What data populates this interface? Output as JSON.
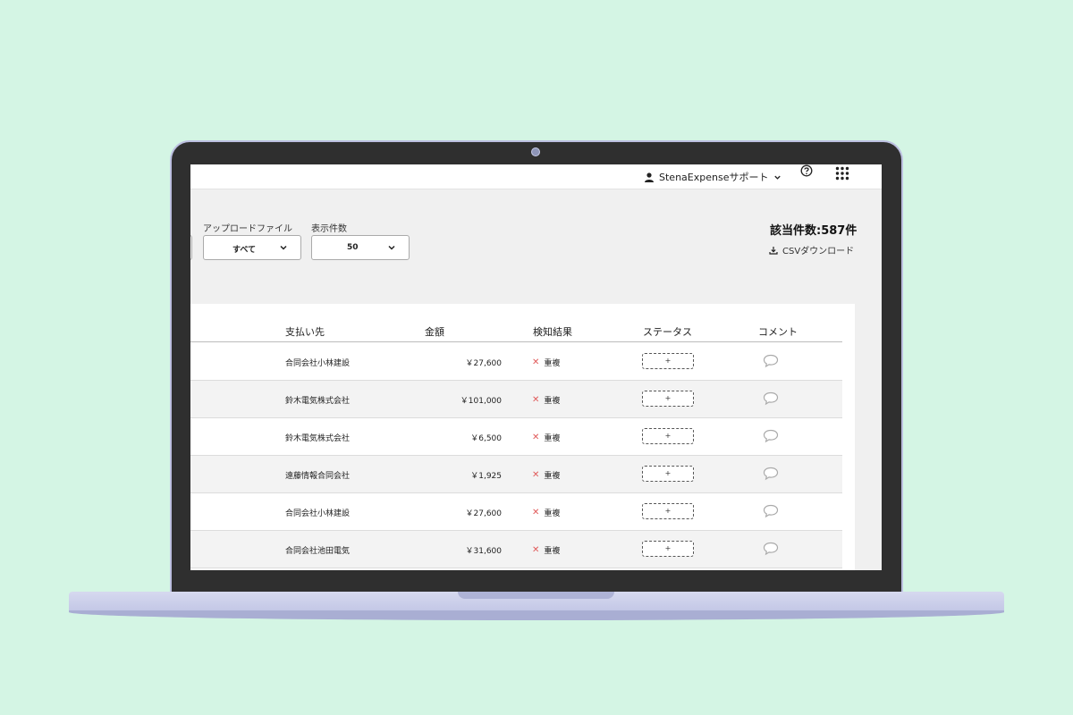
{
  "header": {
    "user_name": "StenaExpenseサポート"
  },
  "filters": {
    "upload_file_label": "アップロードファイル",
    "upload_file_value": "すべて",
    "page_size_label": "表示件数",
    "page_size_value": "50"
  },
  "summary": {
    "count_text": "該当件数:587件",
    "csv_download": "CSVダウンロード"
  },
  "table": {
    "columns": [
      "支払い先",
      "金額",
      "検知結果",
      "ステータス",
      "コメント"
    ],
    "status_button_label": "+",
    "rows": [
      {
        "payee": "合同会社小林建設",
        "amount": "￥27,600",
        "result": "重複"
      },
      {
        "payee": "鈴木電気株式会社",
        "amount": "￥101,000",
        "result": "重複"
      },
      {
        "payee": "鈴木電気株式会社",
        "amount": "￥6,500",
        "result": "重複"
      },
      {
        "payee": "遠藤情報合同会社",
        "amount": "￥1,925",
        "result": "重複"
      },
      {
        "payee": "合同会社小林建設",
        "amount": "￥27,600",
        "result": "重複"
      },
      {
        "payee": "合同会社池田電気",
        "amount": "￥31,600",
        "result": "重複"
      }
    ]
  },
  "colors": {
    "background": "#d4f5e4",
    "laptop_bezel": "#2f2f2f",
    "laptop_base": "#c8cbe8",
    "error_mark": "#e05a5a"
  },
  "icons": [
    "user-icon",
    "chevron-down-icon",
    "help-icon",
    "apps-grid-icon",
    "download-icon",
    "close-icon",
    "comment-icon"
  ]
}
